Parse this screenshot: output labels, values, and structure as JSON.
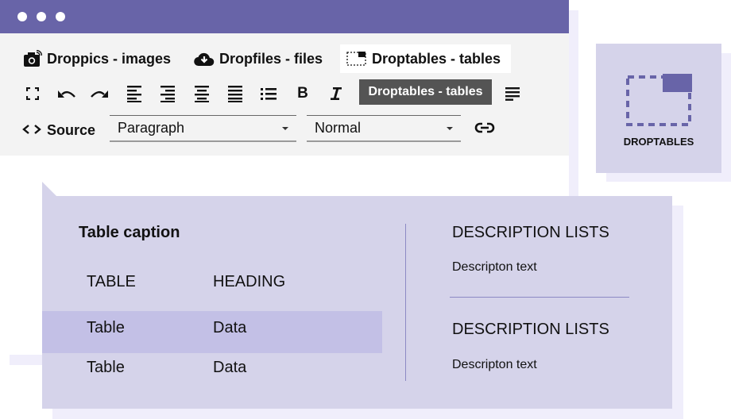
{
  "window": {
    "titlebar_color": "#6864a8",
    "dots": 3
  },
  "plugins": [
    {
      "label": "Droppics - images",
      "icon": "camera-icon",
      "active": false
    },
    {
      "label": "Dropfiles - files",
      "icon": "cloud-download-icon",
      "active": false
    },
    {
      "label": "Droptables - tables",
      "icon": "droptables-icon",
      "active": true
    }
  ],
  "toolbar": {
    "tools": [
      {
        "name": "fullscreen",
        "icon": "fullscreen-icon"
      },
      {
        "name": "undo",
        "icon": "undo-icon"
      },
      {
        "name": "redo",
        "icon": "redo-icon"
      },
      {
        "name": "align-left",
        "icon": "align-left-icon"
      },
      {
        "name": "align-right",
        "icon": "align-right-icon"
      },
      {
        "name": "align-center",
        "icon": "align-center-icon"
      },
      {
        "name": "justify",
        "icon": "align-justify-icon"
      },
      {
        "name": "bullet-list",
        "icon": "list-icon"
      },
      {
        "name": "bold",
        "label": "B"
      },
      {
        "name": "italic",
        "label": "I"
      },
      {
        "name": "paragraph-format",
        "icon": "align-icon"
      }
    ],
    "tooltip": "Droptables - tables",
    "source_label": "Source",
    "block_format": {
      "value": "Paragraph"
    },
    "style_format": {
      "value": "Normal"
    },
    "link_icon": "link-icon"
  },
  "tile": {
    "label": "DROPTABLES",
    "accent": "#6864a8"
  },
  "preview": {
    "caption": "Table caption",
    "headers": [
      "TABLE",
      "HEADING"
    ],
    "rows": [
      [
        "Table",
        "Data"
      ],
      [
        "Table",
        "Data"
      ]
    ],
    "description_lists": [
      {
        "title": "DESCRIPTION LISTS",
        "text": "Descripton text"
      },
      {
        "title": "DESCRIPTION LISTS",
        "text": "Descripton text"
      }
    ]
  },
  "colors": {
    "accent": "#6864a8",
    "panel": "#d5d3ea",
    "highlight_row": "#c3c0e6",
    "shadow": "#f0eefb",
    "toolbar_bg": "#f3f3f3",
    "tooltip_bg": "#545454"
  }
}
